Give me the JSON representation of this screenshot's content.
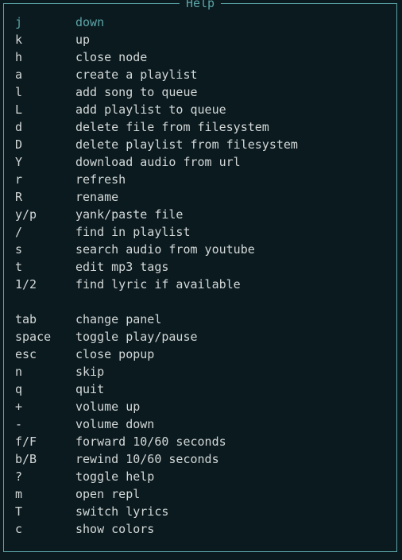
{
  "title": "Help",
  "groups": [
    [
      {
        "key": "j",
        "desc": "down",
        "highlight": true
      },
      {
        "key": "k",
        "desc": "up"
      },
      {
        "key": "h",
        "desc": "close node"
      },
      {
        "key": "a",
        "desc": "create a playlist"
      },
      {
        "key": "l",
        "desc": "add song to queue"
      },
      {
        "key": "L",
        "desc": "add playlist to queue"
      },
      {
        "key": "d",
        "desc": "delete file from filesystem"
      },
      {
        "key": "D",
        "desc": "delete playlist from filesystem"
      },
      {
        "key": "Y",
        "desc": "download audio from url"
      },
      {
        "key": "r",
        "desc": "refresh"
      },
      {
        "key": "R",
        "desc": "rename"
      },
      {
        "key": "y/p",
        "desc": "yank/paste file"
      },
      {
        "key": "/",
        "desc": "find in playlist"
      },
      {
        "key": "s",
        "desc": "search audio from youtube"
      },
      {
        "key": "t",
        "desc": "edit mp3 tags"
      },
      {
        "key": "1/2",
        "desc": "find lyric if available"
      }
    ],
    [
      {
        "key": "tab",
        "desc": "change panel"
      },
      {
        "key": "space",
        "desc": "toggle play/pause"
      },
      {
        "key": "esc",
        "desc": "close popup"
      },
      {
        "key": "n",
        "desc": "skip"
      },
      {
        "key": "q",
        "desc": "quit"
      },
      {
        "key": "+",
        "desc": "volume up"
      },
      {
        "key": "-",
        "desc": "volume down"
      },
      {
        "key": "f/F",
        "desc": "forward 10/60 seconds"
      },
      {
        "key": "b/B",
        "desc": "rewind 10/60 seconds"
      },
      {
        "key": "?",
        "desc": "toggle help"
      },
      {
        "key": "m",
        "desc": "open repl"
      },
      {
        "key": "T",
        "desc": "switch lyrics"
      },
      {
        "key": "c",
        "desc": "show colors"
      }
    ]
  ]
}
